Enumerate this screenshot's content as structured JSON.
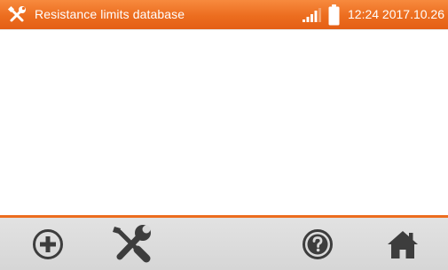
{
  "header": {
    "title": "Resistance limits database",
    "title_icon": "tools-icon",
    "signal_icon": "signal-strength-icon",
    "battery_icon": "battery-icon",
    "clock": "12:24 2017.10.26"
  },
  "toolbar": {
    "buttons": [
      {
        "id": "add",
        "icon": "plus-circle-icon"
      },
      {
        "id": "settings",
        "icon": "tools-icon"
      },
      {
        "id": "help",
        "icon": "question-circle-icon"
      },
      {
        "id": "home",
        "icon": "home-icon"
      }
    ]
  },
  "colors": {
    "accent": "#ec6d1f",
    "toolbar_bg": "#d9d9d9",
    "icon": "#3d3d3d",
    "text_light": "#ffffff"
  }
}
